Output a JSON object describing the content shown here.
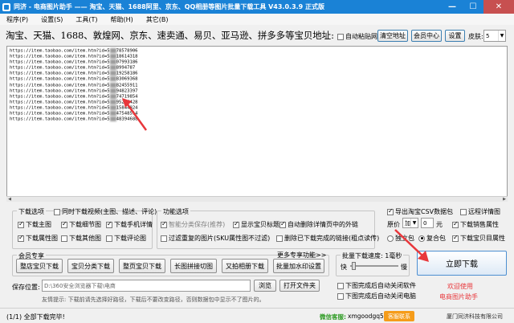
{
  "window": {
    "title": "同济 - 电商图片助手 —— 淘宝、天猫、1688阿里、京东、QQ相册等图片批量下载工具 V43.0.3.9 正式版",
    "minimize": "—",
    "maximize": "☐",
    "close": "✕"
  },
  "menu": [
    "程序(P)",
    "设置(S)",
    "工具(T)",
    "帮助(H)",
    "其它(B)"
  ],
  "header": {
    "label": "淘宝、天猫、1688、敦煌网、京东、速卖通、易贝、亚马逊、拼多多等宝贝地址:",
    "auto_paste_label": "自动粘贴网址",
    "clear_button": "清空地址",
    "member_button": "会员中心",
    "settings_button": "设置",
    "skin_label": "皮肤:",
    "skin_value": "5"
  },
  "url_list": {
    "prefix": "https://item.taobao.com/item.htm?id=5",
    "suffixes": [
      "78578906",
      "18614318",
      "07993186",
      "8994787",
      "19258186",
      "83069368",
      "82455911",
      "94823397",
      "74719854",
      "95207428",
      "15844824",
      "47548514",
      "48394688"
    ]
  },
  "download_options": {
    "title": "下载选项",
    "video_label": "同时下载视频(主图、描述、评论)",
    "items": [
      {
        "label": "下载主图",
        "checked": true
      },
      {
        "label": "下载细节图",
        "checked": true
      },
      {
        "label": "下载手机详情",
        "checked": true
      },
      {
        "label": "下载属性图",
        "checked": true
      },
      {
        "label": "下载其他图",
        "checked": false
      },
      {
        "label": "下载评论图",
        "checked": false
      }
    ]
  },
  "function_options": {
    "title": "功能选项",
    "items": [
      {
        "label": "智能分类保存(推荐)",
        "checked": true,
        "disabled": true
      },
      {
        "label": "显示宝贝标题",
        "checked": true
      },
      {
        "label": "自动删除详情页中的外链",
        "checked": true
      },
      {
        "label": "过滤重复的图片(SKU属性图不过滤)",
        "checked": false
      },
      {
        "label": "删除已下载完成的链接(粗点读传)",
        "checked": false
      }
    ]
  },
  "right_options": {
    "export_csv": "导出淘宝CSV数据包",
    "remote_detail": "远程详情图",
    "price_label": "原价",
    "price_op": "加",
    "price_value": "0",
    "price_unit": "元",
    "sales_attr": "下载销售属性",
    "radio_tmall": "独立包",
    "radio_combined": "复合包",
    "combined_label": "下载宝贝目属性"
  },
  "member": {
    "title": "会员专享",
    "more": "更多专享功能>>",
    "buttons": [
      "整店宝贝下载",
      "宝贝分类下载",
      "整页宝贝下载",
      "长图拼接切图",
      "又拍相册下载",
      "批量加水印设置"
    ]
  },
  "speed": {
    "label": "批量下载速度: 1毫秒",
    "slow": "快",
    "fast": "慢"
  },
  "after_download": {
    "open_folder": "下图完成后自动关闭软件",
    "shutdown": "下图完成后自动关闭电脑"
  },
  "start_button": "立即下载",
  "welcome": {
    "line1": "欢迎使用",
    "line2": "电商图片助手"
  },
  "save": {
    "label": "保存位置:",
    "path": "D:\\360安全浏览器下载\\电商",
    "browse": "浏览",
    "open_folder": "打开文件夹"
  },
  "tip": "友情提示: 下载前请先选择好路径，下载后不要改变路径，否则数据包中显示不了图片的。",
  "status": {
    "left": "(1/1) 全部下载完毕!",
    "wechat_label": "微信客服: ",
    "wechat_id": "xmgoodgq5",
    "badge": "客服联系",
    "company": "厦门同济科技有限公司"
  },
  "colors": {
    "title_bar": "#1a82d6",
    "start_button_border": "#4d8fd1",
    "welcome": "#e8373b",
    "arrow": "#e8373b"
  }
}
